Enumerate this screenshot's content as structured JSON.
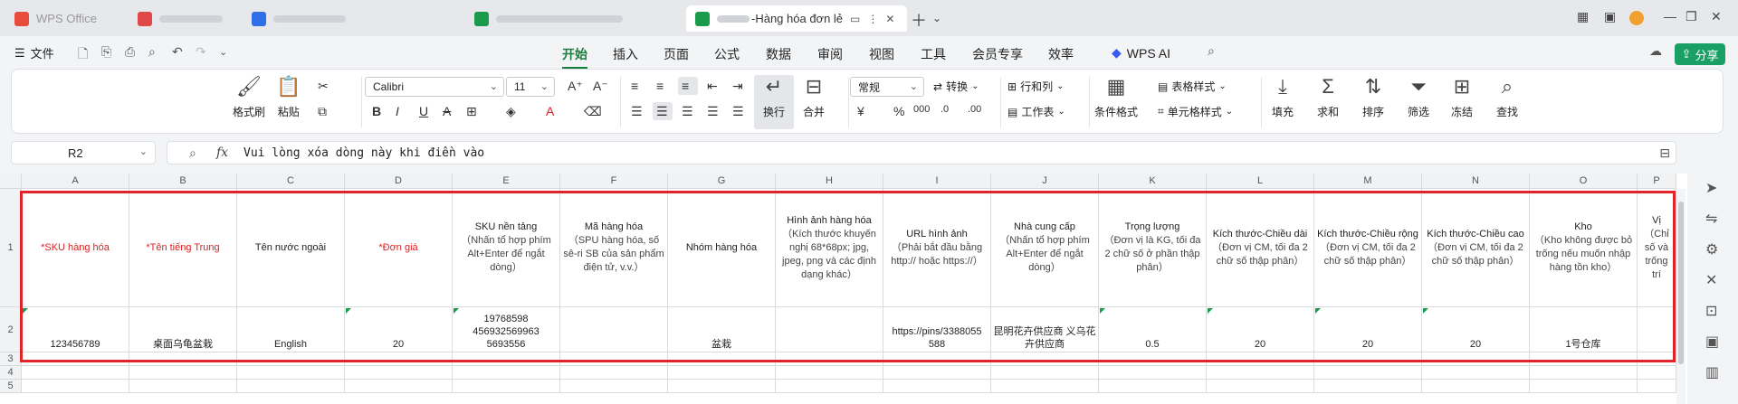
{
  "tabs": [
    {
      "label": "WPS Office",
      "color": "#e74c3c"
    },
    {
      "label": "",
      "color": "#e04848"
    },
    {
      "label": "",
      "color": "#2f6ee6"
    },
    {
      "label": "",
      "color": "#1a9b4b"
    },
    {
      "label": "-Hàng hóa đơn lẻ",
      "color": "#1a9b4b",
      "active": true
    }
  ],
  "menu": {
    "file": "文件",
    "tabs": [
      "开始",
      "插入",
      "页面",
      "公式",
      "数据",
      "审阅",
      "视图",
      "工具",
      "会员专享",
      "效率"
    ],
    "active_tab": "开始",
    "wps_ai": "WPS AI",
    "share": "分享"
  },
  "ribbon": {
    "format_painter": "格式刷",
    "paste": "粘贴",
    "font_name": "Calibri",
    "font_size": "11",
    "wrap": "换行",
    "merge": "合并",
    "number_format": "常规",
    "convert": "转换",
    "row_col": "行和列",
    "worksheet": "工作表",
    "cond_format": "条件格式",
    "table_style": "表格样式",
    "cell_style": "单元格样式",
    "fill": "填充",
    "sum": "求和",
    "sort": "排序",
    "filter": "筛选",
    "freeze": "冻结",
    "find": "查找"
  },
  "formula": {
    "name_box": "R2",
    "content": "Vui lòng xóa dòng này khi điền vào"
  },
  "columns": [
    "A",
    "B",
    "C",
    "D",
    "E",
    "F",
    "G",
    "H",
    "I",
    "J",
    "K",
    "L",
    "M",
    "N",
    "O",
    "P"
  ],
  "rows": [
    "1",
    "2",
    "3",
    "4",
    "5"
  ],
  "headers": [
    {
      "title": "*SKU hàng hóa",
      "required": true,
      "note": ""
    },
    {
      "title": "*Tên tiếng Trung",
      "required": true,
      "note": ""
    },
    {
      "title": "Tên nước ngoài",
      "required": false,
      "note": ""
    },
    {
      "title": "*Đơn giá",
      "required": true,
      "note": ""
    },
    {
      "title": "SKU nền tảng",
      "required": false,
      "note": "（Nhấn tổ hợp phím Alt+Enter để ngắt dòng）"
    },
    {
      "title": "Mã hàng hóa",
      "required": false,
      "note": "（SPU hàng hóa, số sê-ri SB của sản phẩm điện tử, v.v.）"
    },
    {
      "title": "Nhóm hàng hóa",
      "required": false,
      "note": ""
    },
    {
      "title": "Hình ảnh hàng hóa",
      "required": false,
      "note": "（Kích thước khuyến nghị 68*68px; jpg, jpeg, png và các định dạng khác）"
    },
    {
      "title": "URL hình ảnh",
      "required": false,
      "note": "（Phải bắt đầu bằng http:// hoặc https://）"
    },
    {
      "title": "Nhà cung cấp",
      "required": false,
      "note": "（Nhấn tổ hợp phím Alt+Enter để ngắt dòng）"
    },
    {
      "title": "Trọng lượng",
      "required": false,
      "note": "（Đơn vị là KG, tối đa 2 chữ số ở phần thập phân）"
    },
    {
      "title": "Kích thước-Chiều dài",
      "required": false,
      "note": "（Đơn vị CM, tối đa 2 chữ số thập phân）"
    },
    {
      "title": "Kích thước-Chiều rộng",
      "required": false,
      "note": "（Đơn vị CM, tối đa 2 chữ số thập phân）"
    },
    {
      "title": "Kích thước-Chiều cao",
      "required": false,
      "note": "（Đơn vị CM, tối đa 2 chữ số thập phân）"
    },
    {
      "title": "Kho",
      "required": false,
      "note": "（Kho không được bỏ trống nếu muốn nhập hàng tồn kho）"
    },
    {
      "title": "Vị",
      "required": false,
      "note": "（Chỉ số và trống trí"
    }
  ],
  "row2": [
    "123456789",
    "桌面乌龟盆栽",
    "English",
    "20",
    "19768598 456932569963 5693556",
    "",
    "盆栽",
    "",
    "https://pins/3388055 588",
    "昆明花卉供应商 义乌花卉供应商",
    "0.5",
    "20",
    "20",
    "20",
    "1号仓库",
    ""
  ]
}
